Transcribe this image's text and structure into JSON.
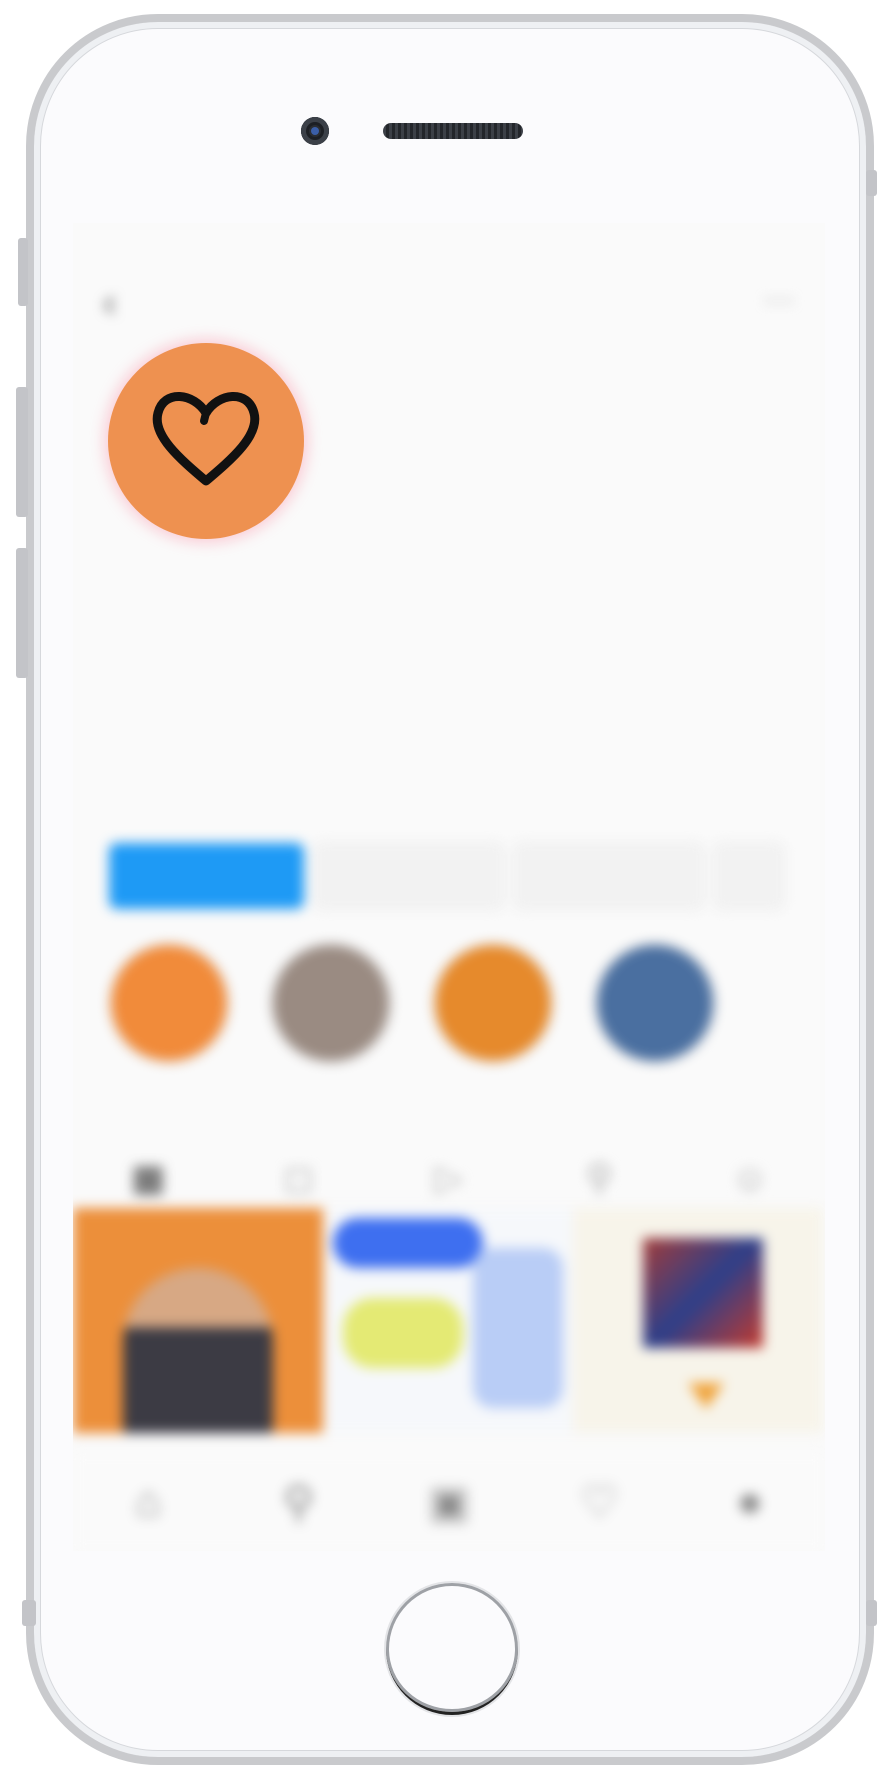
{
  "profile": {
    "username": "",
    "stats": [
      {
        "num": "",
        "label": ""
      },
      {
        "num": "",
        "label": ""
      },
      {
        "num": "",
        "label": ""
      }
    ],
    "bio": {
      "name": "",
      "lines": [
        "",
        "",
        "",
        "",
        ""
      ]
    },
    "buttons": {
      "follow": "",
      "message": "",
      "contact": "",
      "more": ""
    },
    "highlights": [
      {
        "label": "",
        "color": "#f18b3a"
      },
      {
        "label": "",
        "color": "#9a8b82"
      },
      {
        "label": "",
        "color": "#e68a2c"
      },
      {
        "label": "",
        "color": "#4a6fa0"
      }
    ]
  },
  "status": {
    "left": "",
    "time": "",
    "right": ""
  },
  "colors": {
    "avatar": "#ee9150",
    "accent_blue": "#1e9af5"
  },
  "icons": {
    "avatar": "heart-outline-icon",
    "tabs": [
      "grid-icon",
      "reels-icon",
      "video-icon",
      "guides-icon",
      "tagged-icon"
    ],
    "nav": [
      "home-icon",
      "search-icon",
      "reels-icon",
      "heart-icon",
      "profile-icon"
    ]
  }
}
